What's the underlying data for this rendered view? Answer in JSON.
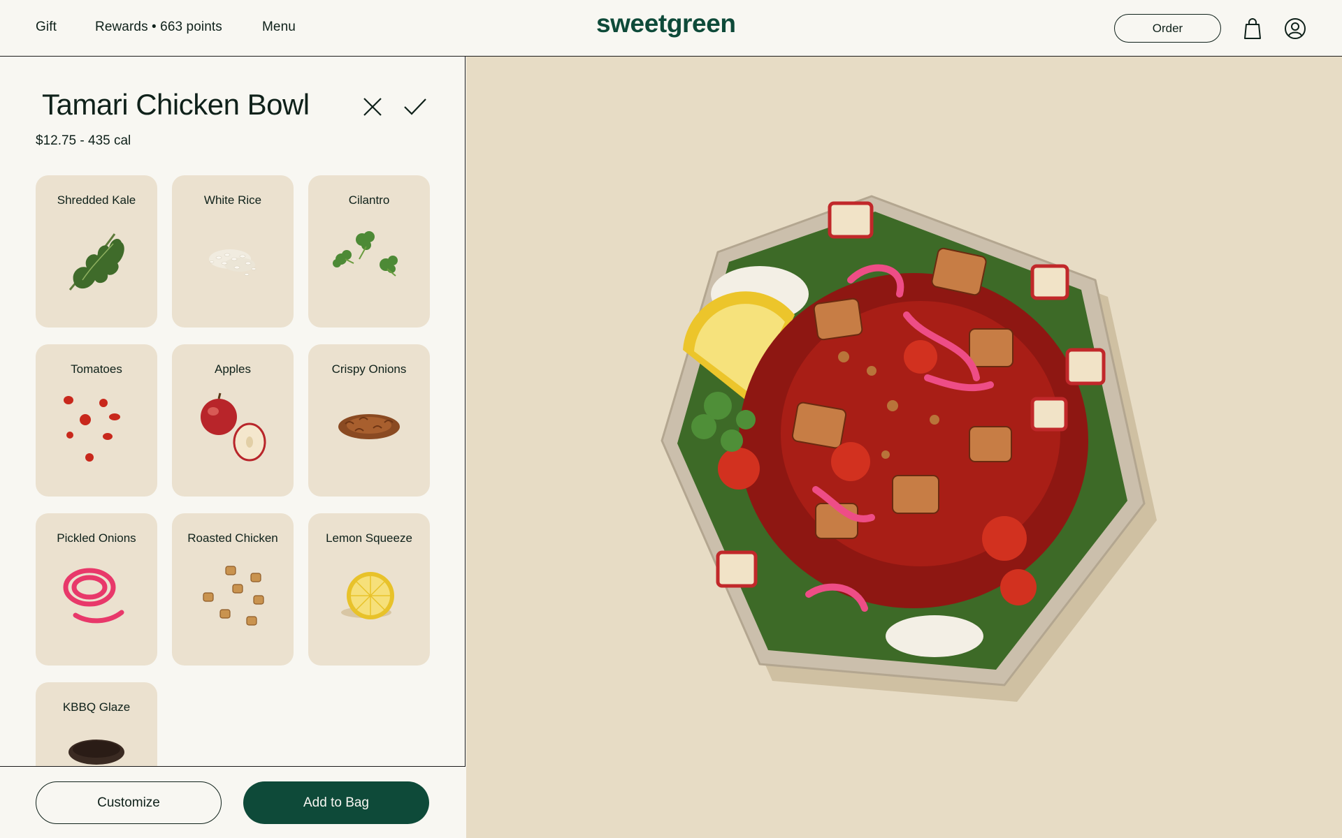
{
  "header": {
    "nav": {
      "gift": "Gift",
      "rewards": "Rewards • 663 points",
      "menu": "Menu"
    },
    "logo": "sweetgreen",
    "order_label": "Order"
  },
  "product": {
    "title": "Tamari Chicken Bowl",
    "price_cal": "$12.75 - 435 cal"
  },
  "ingredients": [
    {
      "name": "Shredded Kale",
      "icon": "kale-icon"
    },
    {
      "name": "White Rice",
      "icon": "rice-icon"
    },
    {
      "name": "Cilantro",
      "icon": "cilantro-icon"
    },
    {
      "name": "Tomatoes",
      "icon": "tomatoes-icon"
    },
    {
      "name": "Apples",
      "icon": "apples-icon"
    },
    {
      "name": "Crispy Onions",
      "icon": "crispy-onions-icon"
    },
    {
      "name": "Pickled Onions",
      "icon": "pickled-onions-icon"
    },
    {
      "name": "Roasted Chicken",
      "icon": "chicken-icon"
    },
    {
      "name": "Lemon Squeeze",
      "icon": "lemon-icon"
    },
    {
      "name": "KBBQ Glaze",
      "icon": "glaze-icon"
    }
  ],
  "actions": {
    "customize_label": "Customize",
    "add_to_bag_label": "Add to Bag"
  },
  "colors": {
    "brand_green": "#0e4a39",
    "page_bg": "#f8f7f2",
    "card_bg": "#ebe1cf",
    "hero_bg": "#e7dcc5"
  }
}
